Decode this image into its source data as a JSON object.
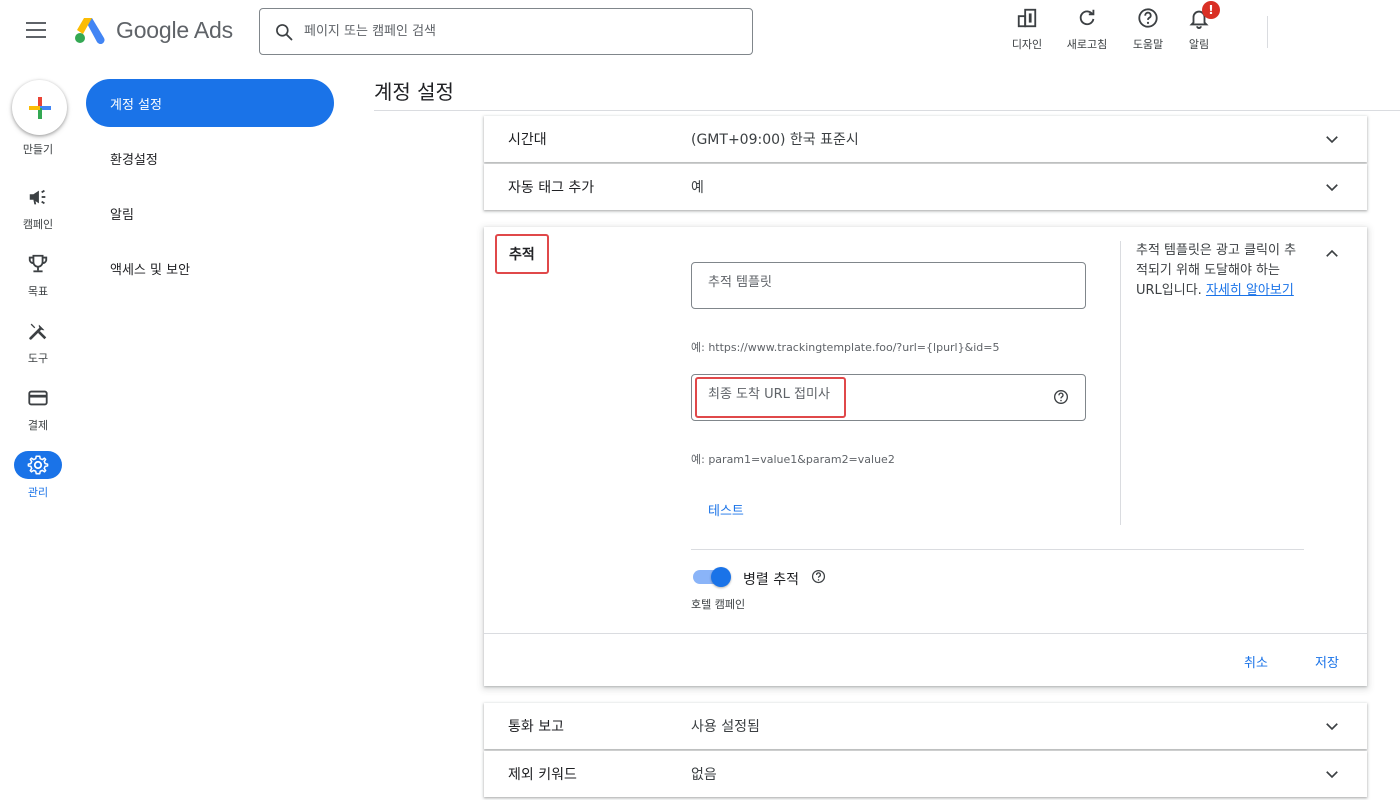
{
  "header": {
    "app_name": "Google Ads",
    "search_placeholder": "페이지 또는 캠페인 검색",
    "actions": [
      {
        "label": "디자인",
        "icon": "appearance-icon"
      },
      {
        "label": "새로고침",
        "icon": "refresh-icon"
      },
      {
        "label": "도움말",
        "icon": "help-icon"
      },
      {
        "label": "알림",
        "icon": "bell-icon",
        "badge": "!"
      }
    ]
  },
  "rail": {
    "items": [
      {
        "label": "만들기",
        "icon": "plus-icon"
      },
      {
        "label": "캠페인",
        "icon": "megaphone-icon"
      },
      {
        "label": "목표",
        "icon": "trophy-icon"
      },
      {
        "label": "도구",
        "icon": "tools-icon"
      },
      {
        "label": "결제",
        "icon": "credit-card-icon"
      },
      {
        "label": "관리",
        "icon": "gear-icon",
        "active": true
      }
    ]
  },
  "subnav": {
    "items": [
      {
        "label": "계정 설정",
        "active": true
      },
      {
        "label": "환경설정"
      },
      {
        "label": "알림"
      },
      {
        "label": "액세스 및 보안"
      }
    ]
  },
  "page": {
    "title": "계정 설정"
  },
  "settings": {
    "timezone": {
      "label": "시간대",
      "value": "(GMT+09:00) 한국 표준시"
    },
    "auto_tagging": {
      "label": "자동 태그 추가",
      "value": "예"
    },
    "call_reporting": {
      "label": "통화 보고",
      "value": "사용 설정됨"
    },
    "negative_keywords": {
      "label": "제외 키워드",
      "value": "없음"
    }
  },
  "tracking": {
    "title": "추적",
    "template_placeholder": "추적 템플릿",
    "template_hint": "예: https://www.trackingtemplate.foo/?url={lpurl}&id=5",
    "suffix_placeholder": "최종 도착 URL 접미사",
    "suffix_hint": "예: param1=value1&param2=value2",
    "test_label": "테스트",
    "help_text": "추적 템플릿은 광고 클릭이 추적되기 위해 도달해야 하는 URL입니다.",
    "help_link": "자세히 알아보기",
    "parallel_label": "병렬 추적",
    "parallel_enabled": true,
    "hotel_label": "호텔 캠페인",
    "cancel_label": "취소",
    "save_label": "저장"
  },
  "colors": {
    "accent": "#1a73e8",
    "highlight": "#e0484a",
    "badge": "#d93025"
  }
}
